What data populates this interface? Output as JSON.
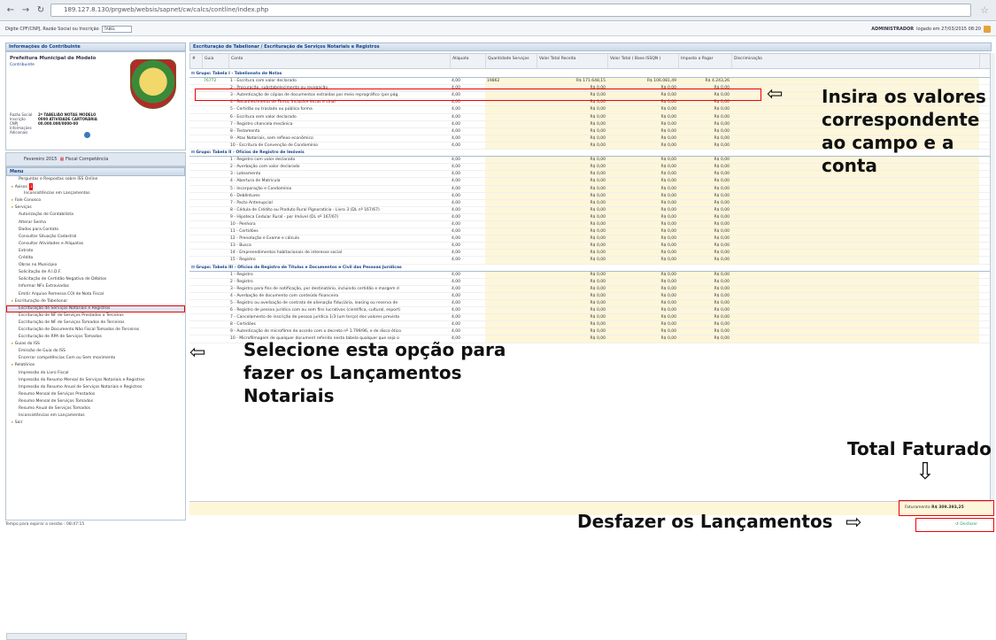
{
  "browser": {
    "url": "189.127.8.130/prgweb/websis/sapnet/cw/calcs/contline/index.php"
  },
  "topbar": {
    "label": "Digite CPF/CNPJ, Razão Social ou Inscrição",
    "input": "TABEL",
    "user": "ADMINISTRADOR",
    "session": "logado em 27/03/2015 08:20"
  },
  "sidebar": {
    "title": "Informações do Contribuinte",
    "org": "Prefeitura Municipal de Modelo",
    "sub": "Contribuinte",
    "fields": [
      {
        "k": "Razão Social",
        "v": "2º TABELIÃO NOTAS MODELO"
      },
      {
        "k": "Inscrição",
        "v": "0000 ATIVIDADE CARTORÁRIA"
      },
      {
        "k": "CNPJ",
        "v": "00.000.000/0000-00"
      },
      {
        "k": "Informações Adicionais",
        "v": ""
      }
    ],
    "competencia": "Fevereiro 2015",
    "competencia_link": "Fiscal Competência",
    "menu_title": "Menu",
    "menu": [
      {
        "t": "Perguntas e Respostas sobre ISS Online",
        "lv": "l2"
      },
      {
        "t": "Avisos",
        "lv": "l1",
        "badge": "3"
      },
      {
        "t": "Inconsistências em Lançamentos",
        "lv": "l3"
      },
      {
        "t": "Fale Conosco",
        "lv": "l1"
      },
      {
        "t": "Serviços",
        "lv": "l1"
      },
      {
        "t": "Autorização de Contabilista",
        "lv": "l2"
      },
      {
        "t": "Alterar Senha",
        "lv": "l2"
      },
      {
        "t": "Dados para Contato",
        "lv": "l2"
      },
      {
        "t": "Consultar Situação Cadastral",
        "lv": "l2"
      },
      {
        "t": "Consultar Atividades e Alíquotas",
        "lv": "l2"
      },
      {
        "t": "Extrato",
        "lv": "l2"
      },
      {
        "t": "Crédito",
        "lv": "l2"
      },
      {
        "t": "Obras no Município",
        "lv": "l2"
      },
      {
        "t": "Solicitação de A.I.D.F.",
        "lv": "l2"
      },
      {
        "t": "Solicitação de Certidão Negativa de Débitos",
        "lv": "l2"
      },
      {
        "t": "Informar NFs Extraviadas",
        "lv": "l2"
      },
      {
        "t": "Emitir Arquivo Remessa COI de Nota Fiscal",
        "lv": "l2"
      },
      {
        "t": "Escrituração de Tabelionar",
        "lv": "l1"
      },
      {
        "t": "Escrituração de Serviços Notariais e Registros",
        "lv": "l2",
        "sel": true
      },
      {
        "t": "Escrituração de NF de Serviços Prestados a Terceiros",
        "lv": "l2"
      },
      {
        "t": "Escrituração de NF de Serviços Tomados de Terceiros",
        "lv": "l2"
      },
      {
        "t": "Escrituração de Documento Não Fiscal Tomados de Terceiros",
        "lv": "l2"
      },
      {
        "t": "Escrituração de RPA de Serviços Tomados",
        "lv": "l2"
      },
      {
        "t": "Guias do ISS",
        "lv": "l1"
      },
      {
        "t": "Emissão de Guia do ISS",
        "lv": "l2"
      },
      {
        "t": "Encerrar competências Com ou Sem movimento",
        "lv": "l2"
      },
      {
        "t": "Relatórios",
        "lv": "l1"
      },
      {
        "t": "Impressão do Livro Fiscal",
        "lv": "l2"
      },
      {
        "t": "Impressão do Resumo Mensal de Serviços Notariais e Registros",
        "lv": "l2"
      },
      {
        "t": "Impressão do Resumo Anual de Serviços Notariais e Registros",
        "lv": "l2"
      },
      {
        "t": "Resumo Mensal de Serviços Prestados",
        "lv": "l2"
      },
      {
        "t": "Resumo Mensal de Serviços Tomados",
        "lv": "l2"
      },
      {
        "t": "Resumo Anual de Serviços Tomados",
        "lv": "l2"
      },
      {
        "t": "Inconsistências em Lançamentos",
        "lv": "l2"
      },
      {
        "t": "Sair",
        "lv": "l1"
      }
    ],
    "session_timer": "Tempo para expirar a sessão : 08:47:15"
  },
  "main": {
    "title": "Escrituração de Tabelionar / Escrituração de Serviços Notariais e Registros",
    "headers": [
      "#",
      "Guia",
      "Conta",
      "Alíquota",
      "Quantidade Serviços",
      "Valor Total Receita",
      "Valor Total ( Base ISSQN )",
      "Imposto a Pagar",
      "Discriminação"
    ],
    "groups": [
      {
        "title": "Grupo: Tabela I - Tabelionato de Notas",
        "rows": [
          [
            "",
            "76772",
            "1 - Escritura com valor declarado",
            "4,00",
            "19862",
            "R$ 171.648,15",
            "R$ 106.081,49",
            "R$ 4.243,26"
          ],
          [
            "",
            "",
            "2 - Procuração, substabelecimento ou revogação",
            "4,00",
            "",
            "R$ 0,00",
            "R$ 0,00",
            "R$ 0,00"
          ],
          [
            "",
            "",
            "3 - Autenticação de cópias de documentos extraídas por meio reprográfico (por pág.",
            "4,00",
            "",
            "R$ 0,00",
            "R$ 0,00",
            "R$ 0,00"
          ],
          [
            "",
            "",
            "4 - Reconhecimento de Firma, inclusive letras e sinal",
            "4,00",
            "",
            "R$ 0,00",
            "R$ 0,00",
            "R$ 0,00"
          ],
          [
            "",
            "",
            "5 - Certidão ou traslado ou pública forma",
            "4,00",
            "",
            "R$ 0,00",
            "R$ 0,00",
            "R$ 0,00"
          ],
          [
            "",
            "",
            "6 - Escritura sem valor declarado",
            "4,00",
            "",
            "R$ 0,00",
            "R$ 0,00",
            "R$ 0,00"
          ],
          [
            "",
            "",
            "7 - Registro chancela mecânica",
            "4,00",
            "",
            "R$ 0,00",
            "R$ 0,00",
            "R$ 0,00"
          ],
          [
            "",
            "",
            "8 - Testamento",
            "4,00",
            "",
            "R$ 0,00",
            "R$ 0,00",
            "R$ 0,00"
          ],
          [
            "",
            "",
            "9 - Atas Notariais, sem reflexo econômico",
            "4,00",
            "",
            "R$ 0,00",
            "R$ 0,00",
            "R$ 0,00"
          ],
          [
            "",
            "",
            "10 - Escritura de Convenção de Condomínio",
            "4,00",
            "",
            "R$ 0,00",
            "R$ 0,00",
            "R$ 0,00"
          ]
        ]
      },
      {
        "title": "Grupo: Tabela II - Ofícios de Registro de Imóveis",
        "rows": [
          [
            "",
            "",
            "1 - Registro com valor declarado",
            "4,00",
            "",
            "R$ 0,00",
            "R$ 0,00",
            "R$ 0,00"
          ],
          [
            "",
            "",
            "2 - Averbação com valor declarado",
            "4,00",
            "",
            "R$ 0,00",
            "R$ 0,00",
            "R$ 0,00"
          ],
          [
            "",
            "",
            "3 - Loteamento",
            "4,00",
            "",
            "R$ 0,00",
            "R$ 0,00",
            "R$ 0,00"
          ],
          [
            "",
            "",
            "4 - Abertura de Matrícula",
            "4,00",
            "",
            "R$ 0,00",
            "R$ 0,00",
            "R$ 0,00"
          ],
          [
            "",
            "",
            "5 - Incorporação e Condomínio",
            "4,00",
            "",
            "R$ 0,00",
            "R$ 0,00",
            "R$ 0,00"
          ],
          [
            "",
            "",
            "6 - Debêntures",
            "4,00",
            "",
            "R$ 0,00",
            "R$ 0,00",
            "R$ 0,00"
          ],
          [
            "",
            "",
            "7 - Pacto Antenupcial",
            "4,00",
            "",
            "R$ 0,00",
            "R$ 0,00",
            "R$ 0,00"
          ],
          [
            "",
            "",
            "8 - Cédula de Crédito ou Produto Rural Pignoratícia - Livro 3 (DL nº 167/67)",
            "4,00",
            "",
            "R$ 0,00",
            "R$ 0,00",
            "R$ 0,00"
          ],
          [
            "",
            "",
            "9 - Hipoteca Cedular Rural - por Imóvel (DL nº 167/67)",
            "4,00",
            "",
            "R$ 0,00",
            "R$ 0,00",
            "R$ 0,00"
          ],
          [
            "",
            "",
            "10 - Penhora",
            "4,00",
            "",
            "R$ 0,00",
            "R$ 0,00",
            "R$ 0,00"
          ],
          [
            "",
            "",
            "11 - Certidões",
            "4,00",
            "",
            "R$ 0,00",
            "R$ 0,00",
            "R$ 0,00"
          ],
          [
            "",
            "",
            "12 - Prenotação e Exame e cálculo",
            "4,00",
            "",
            "R$ 0,00",
            "R$ 0,00",
            "R$ 0,00"
          ],
          [
            "",
            "",
            "13 - Busca",
            "4,00",
            "",
            "R$ 0,00",
            "R$ 0,00",
            "R$ 0,00"
          ],
          [
            "",
            "",
            "14 - Empreendimentos habitacionais de interesse social",
            "4,00",
            "",
            "R$ 0,00",
            "R$ 0,00",
            "R$ 0,00"
          ],
          [
            "",
            "",
            "15 - Registro",
            "4,00",
            "",
            "R$ 0,00",
            "R$ 0,00",
            "R$ 0,00"
          ]
        ]
      },
      {
        "title": "Grupo: Tabela III - Ofícios de Registro de Títulos e Documentos e Civil das Pessoas Jurídicas",
        "rows": [
          [
            "",
            "",
            "1 - Registro",
            "4,00",
            "",
            "R$ 0,00",
            "R$ 0,00",
            "R$ 0,00"
          ],
          [
            "",
            "",
            "2 - Registro",
            "4,00",
            "",
            "R$ 0,00",
            "R$ 0,00",
            "R$ 0,00"
          ],
          [
            "",
            "",
            "3 - Registro para fins de notificação, por destinatário, incluindo certidão e margem d",
            "4,00",
            "",
            "R$ 0,00",
            "R$ 0,00",
            "R$ 0,00"
          ],
          [
            "",
            "",
            "4 - Averbação de documento com conteúdo financeiro",
            "4,00",
            "",
            "R$ 0,00",
            "R$ 0,00",
            "R$ 0,00"
          ],
          [
            "",
            "",
            "5 - Registro ou averbação de contrato de alienação fiduciária, leasing ou reserva de",
            "4,00",
            "",
            "R$ 0,00",
            "R$ 0,00",
            "R$ 0,00"
          ],
          [
            "",
            "",
            "6 - Registro de pessoa jurídica com ou sem fins lucrativos (científica, cultural, esporti",
            "4,00",
            "",
            "R$ 0,00",
            "R$ 0,00",
            "R$ 0,00"
          ],
          [
            "",
            "",
            "7 - Cancelamento de inscrição de pessoa jurídica 1/3 (um terço) dos valores previsto",
            "4,00",
            "",
            "R$ 0,00",
            "R$ 0,00",
            "R$ 0,00"
          ],
          [
            "",
            "",
            "8 - Certidões",
            "4,00",
            "",
            "R$ 0,00",
            "R$ 0,00",
            "R$ 0,00"
          ],
          [
            "",
            "",
            "9 - Autenticação de microfilme de acordo com o decreto nº 1.799/96, e de disco ótico",
            "4,00",
            "",
            "R$ 0,00",
            "R$ 0,00",
            "R$ 0,00"
          ],
          [
            "",
            "",
            "10 - Microfilmagem de qualquer document referido nesta tabela qualquer que seja o",
            "4,00",
            "",
            "R$ 0,00",
            "R$ 0,00",
            "R$ 0,00"
          ]
        ]
      }
    ],
    "total_label": "Faturamento",
    "total_value": "R$ 309.393,25",
    "undo_label": "Desfazer"
  },
  "callouts": {
    "insira": "Insira os valores correspondente ao campo e a conta",
    "selecione": "Selecione esta opção para fazer os Lançamentos Notariais",
    "total": "Total Faturado",
    "desfazer": "Desfazer os Lançamentos"
  }
}
